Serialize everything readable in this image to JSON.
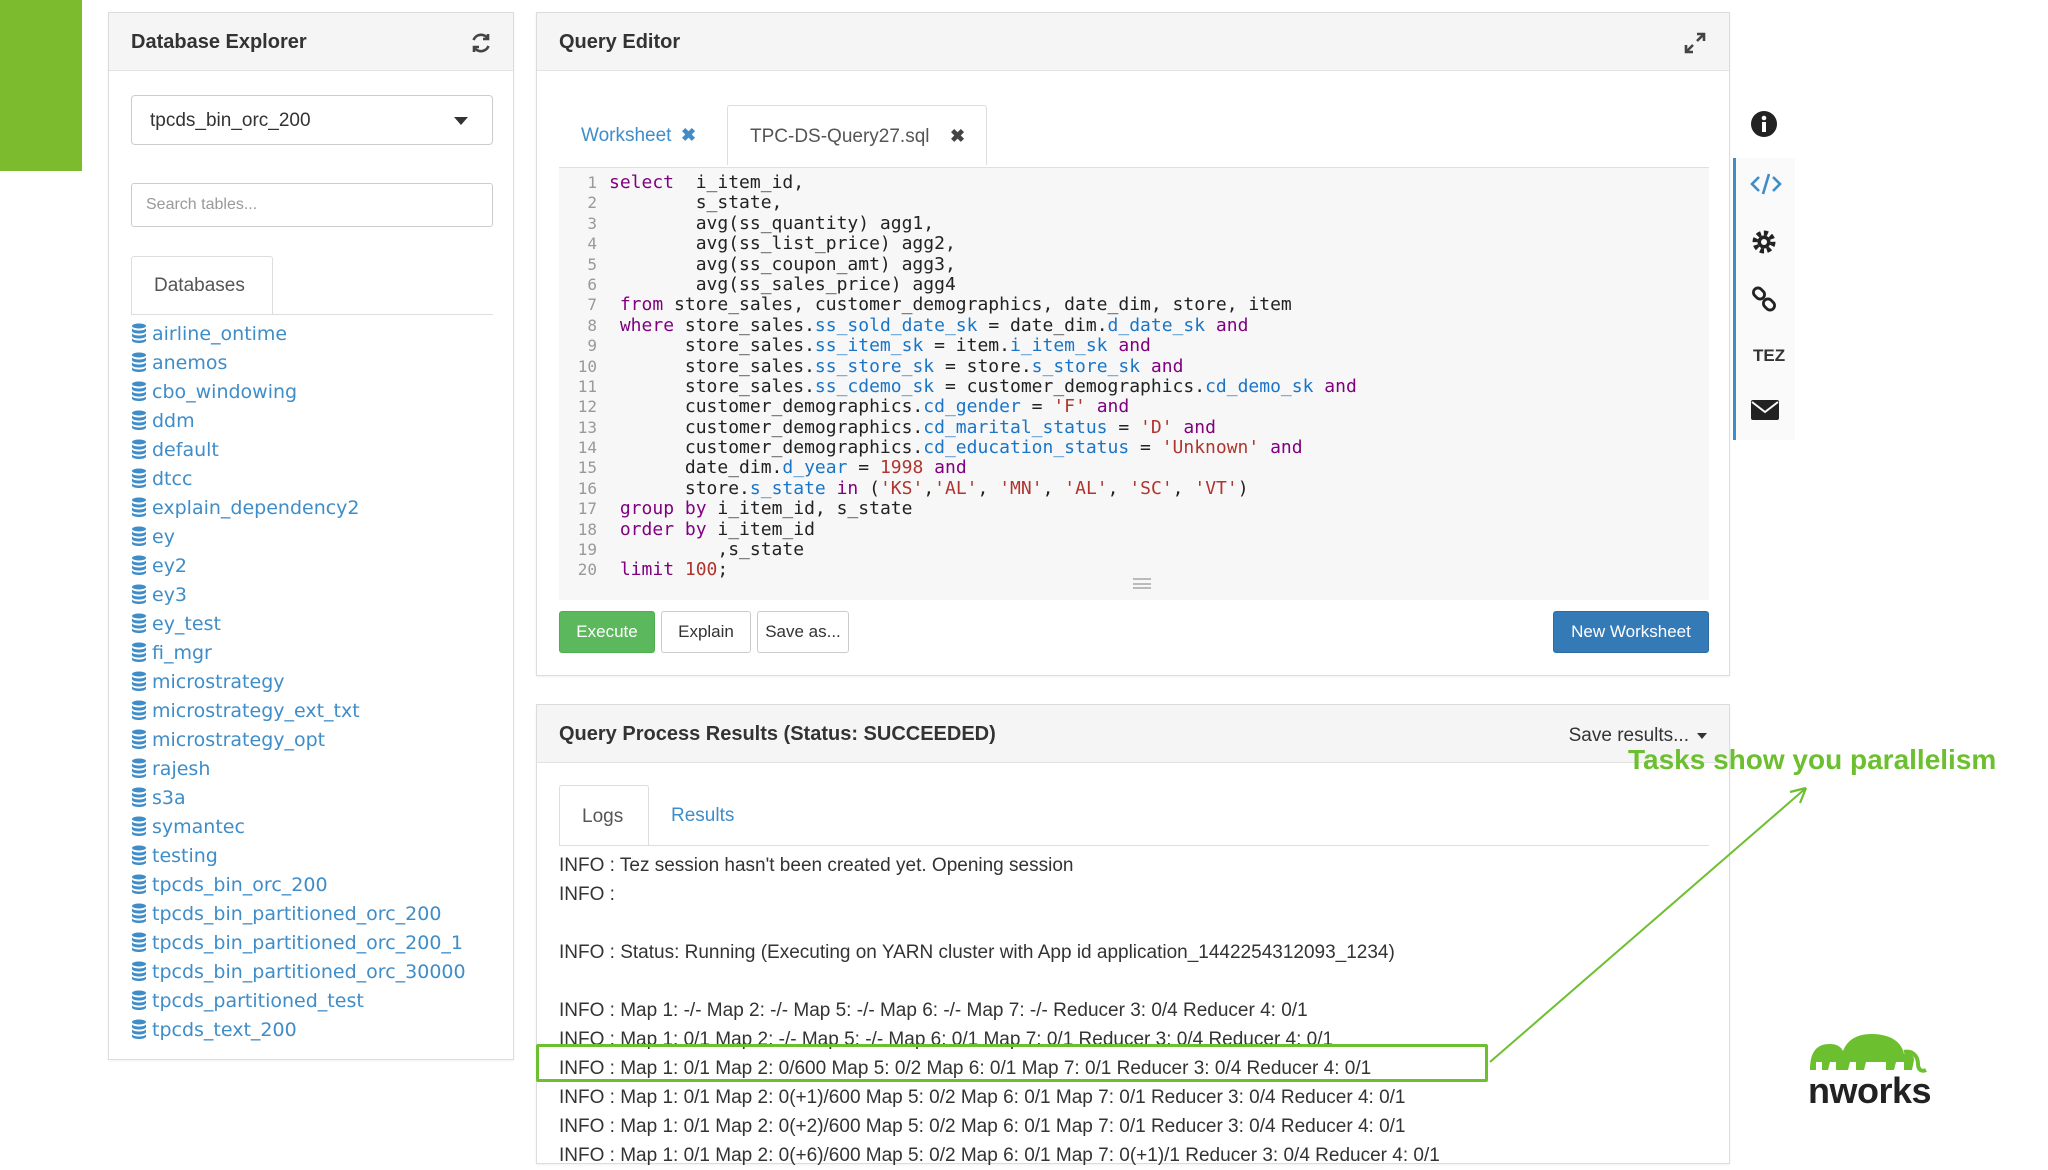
{
  "colors": {
    "accent_green": "#7dbb2e",
    "link_blue": "#3f8dc8",
    "execute_green": "#5cb85c",
    "primary_blue": "#337ab7",
    "annotation_green": "#6cbf2e"
  },
  "db_explorer": {
    "title": "Database Explorer",
    "refresh_icon": "refresh-icon",
    "selected_database": "tpcds_bin_orc_200",
    "search_placeholder": "Search tables...",
    "tab_label": "Databases",
    "databases": [
      "airline_ontime",
      "anemos",
      "cbo_windowing",
      "ddm",
      "default",
      "dtcc",
      "explain_dependency2",
      "ey",
      "ey2",
      "ey3",
      "ey_test",
      "fi_mgr",
      "microstrategy",
      "microstrategy_ext_txt",
      "microstrategy_opt",
      "rajesh",
      "s3a",
      "symantec",
      "testing",
      "tpcds_bin_orc_200",
      "tpcds_bin_partitioned_orc_200",
      "tpcds_bin_partitioned_orc_200_1",
      "tpcds_bin_partitioned_orc_30000",
      "tpcds_partitioned_test",
      "tpcds_text_200"
    ]
  },
  "query_editor": {
    "title": "Query Editor",
    "expand_icon": "expand-icon",
    "tabs": [
      {
        "label": "Worksheet",
        "close": "✖"
      },
      {
        "label": "TPC-DS-Query27.sql",
        "close": "✖"
      }
    ],
    "code_lines": [
      [
        {
          "t": "select",
          "c": "k"
        },
        {
          "t": "  i_item_id,"
        }
      ],
      [
        {
          "t": "        s_state,"
        }
      ],
      [
        {
          "t": "        avg(ss_quantity) agg1,"
        }
      ],
      [
        {
          "t": "        avg(ss_list_price) agg2,"
        }
      ],
      [
        {
          "t": "        avg(ss_coupon_amt) agg3,"
        }
      ],
      [
        {
          "t": "        avg(ss_sales_price) agg4"
        }
      ],
      [
        {
          "t": " "
        },
        {
          "t": "from",
          "c": "k"
        },
        {
          "t": " store_sales, customer_demographics, date_dim, store, item"
        }
      ],
      [
        {
          "t": " "
        },
        {
          "t": "where",
          "c": "k"
        },
        {
          "t": " store_sales."
        },
        {
          "t": "ss_sold_date_sk",
          "c": "f"
        },
        {
          "t": " = date_dim."
        },
        {
          "t": "d_date_sk",
          "c": "f"
        },
        {
          "t": " "
        },
        {
          "t": "and",
          "c": "k"
        }
      ],
      [
        {
          "t": "       store_sales."
        },
        {
          "t": "ss_item_sk",
          "c": "f"
        },
        {
          "t": " = item."
        },
        {
          "t": "i_item_sk",
          "c": "f"
        },
        {
          "t": " "
        },
        {
          "t": "and",
          "c": "k"
        }
      ],
      [
        {
          "t": "       store_sales."
        },
        {
          "t": "ss_store_sk",
          "c": "f"
        },
        {
          "t": " = store."
        },
        {
          "t": "s_store_sk",
          "c": "f"
        },
        {
          "t": " "
        },
        {
          "t": "and",
          "c": "k"
        }
      ],
      [
        {
          "t": "       store_sales."
        },
        {
          "t": "ss_cdemo_sk",
          "c": "f"
        },
        {
          "t": " = customer_demographics."
        },
        {
          "t": "cd_demo_sk",
          "c": "f"
        },
        {
          "t": " "
        },
        {
          "t": "and",
          "c": "k"
        }
      ],
      [
        {
          "t": "       customer_demographics."
        },
        {
          "t": "cd_gender",
          "c": "f"
        },
        {
          "t": " = "
        },
        {
          "t": "'F'",
          "c": "s"
        },
        {
          "t": " "
        },
        {
          "t": "and",
          "c": "k"
        }
      ],
      [
        {
          "t": "       customer_demographics."
        },
        {
          "t": "cd_marital_status",
          "c": "f"
        },
        {
          "t": " = "
        },
        {
          "t": "'D'",
          "c": "s"
        },
        {
          "t": " "
        },
        {
          "t": "and",
          "c": "k"
        }
      ],
      [
        {
          "t": "       customer_demographics."
        },
        {
          "t": "cd_education_status",
          "c": "f"
        },
        {
          "t": " = "
        },
        {
          "t": "'Unknown'",
          "c": "s"
        },
        {
          "t": " "
        },
        {
          "t": "and",
          "c": "k"
        }
      ],
      [
        {
          "t": "       date_dim."
        },
        {
          "t": "d_year",
          "c": "f"
        },
        {
          "t": " = "
        },
        {
          "t": "1998",
          "c": "n"
        },
        {
          "t": " "
        },
        {
          "t": "and",
          "c": "k"
        }
      ],
      [
        {
          "t": "       store."
        },
        {
          "t": "s_state",
          "c": "f"
        },
        {
          "t": " "
        },
        {
          "t": "in",
          "c": "k"
        },
        {
          "t": " ("
        },
        {
          "t": "'KS'",
          "c": "s"
        },
        {
          "t": ","
        },
        {
          "t": "'AL'",
          "c": "s"
        },
        {
          "t": ", "
        },
        {
          "t": "'MN'",
          "c": "s"
        },
        {
          "t": ", "
        },
        {
          "t": "'AL'",
          "c": "s"
        },
        {
          "t": ", "
        },
        {
          "t": "'SC'",
          "c": "s"
        },
        {
          "t": ", "
        },
        {
          "t": "'VT'",
          "c": "s"
        },
        {
          "t": ")"
        }
      ],
      [
        {
          "t": " "
        },
        {
          "t": "group by",
          "c": "k"
        },
        {
          "t": " i_item_id, s_state"
        }
      ],
      [
        {
          "t": " "
        },
        {
          "t": "order by",
          "c": "k"
        },
        {
          "t": " i_item_id"
        }
      ],
      [
        {
          "t": "          ,s_state"
        }
      ],
      [
        {
          "t": " "
        },
        {
          "t": "limit",
          "c": "k"
        },
        {
          "t": " "
        },
        {
          "t": "100",
          "c": "n"
        },
        {
          "t": ";"
        }
      ]
    ],
    "buttons": {
      "execute": "Execute",
      "explain": "Explain",
      "save_as": "Save as...",
      "new_worksheet": "New Worksheet"
    }
  },
  "side_tools": [
    {
      "icon": "info-icon"
    },
    {
      "icon": "code-icon"
    },
    {
      "icon": "gear-icon"
    },
    {
      "icon": "link-icon"
    },
    {
      "label": "TEZ"
    },
    {
      "icon": "envelope-icon"
    }
  ],
  "results": {
    "title": "Query Process Results (Status: SUCCEEDED)",
    "save_results": "Save results...",
    "tabs": {
      "logs": "Logs",
      "results": "Results"
    },
    "log_lines": [
      "INFO : Tez session hasn't been created yet. Opening session",
      "INFO :",
      "",
      "INFO : Status: Running (Executing on YARN cluster with App id application_1442254312093_1234)",
      "",
      "INFO : Map 1: -/- Map 2: -/- Map 5: -/- Map 6: -/- Map 7: -/- Reducer 3: 0/4 Reducer 4: 0/1",
      "INFO : Map 1: 0/1 Map 2: -/- Map 5: -/- Map 6: 0/1 Map 7: 0/1 Reducer 3: 0/4 Reducer 4: 0/1",
      "INFO : Map 1: 0/1 Map 2: 0/600 Map 5: 0/2 Map 6: 0/1 Map 7: 0/1 Reducer 3: 0/4 Reducer 4: 0/1",
      "INFO : Map 1: 0/1 Map 2: 0(+1)/600 Map 5: 0/2 Map 6: 0/1 Map 7: 0/1 Reducer 3: 0/4 Reducer 4: 0/1",
      "INFO : Map 1: 0/1 Map 2: 0(+2)/600 Map 5: 0/2 Map 6: 0/1 Map 7: 0/1 Reducer 3: 0/4 Reducer 4: 0/1",
      "INFO : Map 1: 0/1 Map 2: 0(+6)/600 Map 5: 0/2 Map 6: 0/1 Map 7: 0(+1)/1 Reducer 3: 0/4 Reducer 4: 0/1"
    ]
  },
  "annotation": {
    "callout_text": "Tasks show you parallelism"
  },
  "logo": {
    "text": "nworks",
    "icon": "elephant-logo"
  }
}
